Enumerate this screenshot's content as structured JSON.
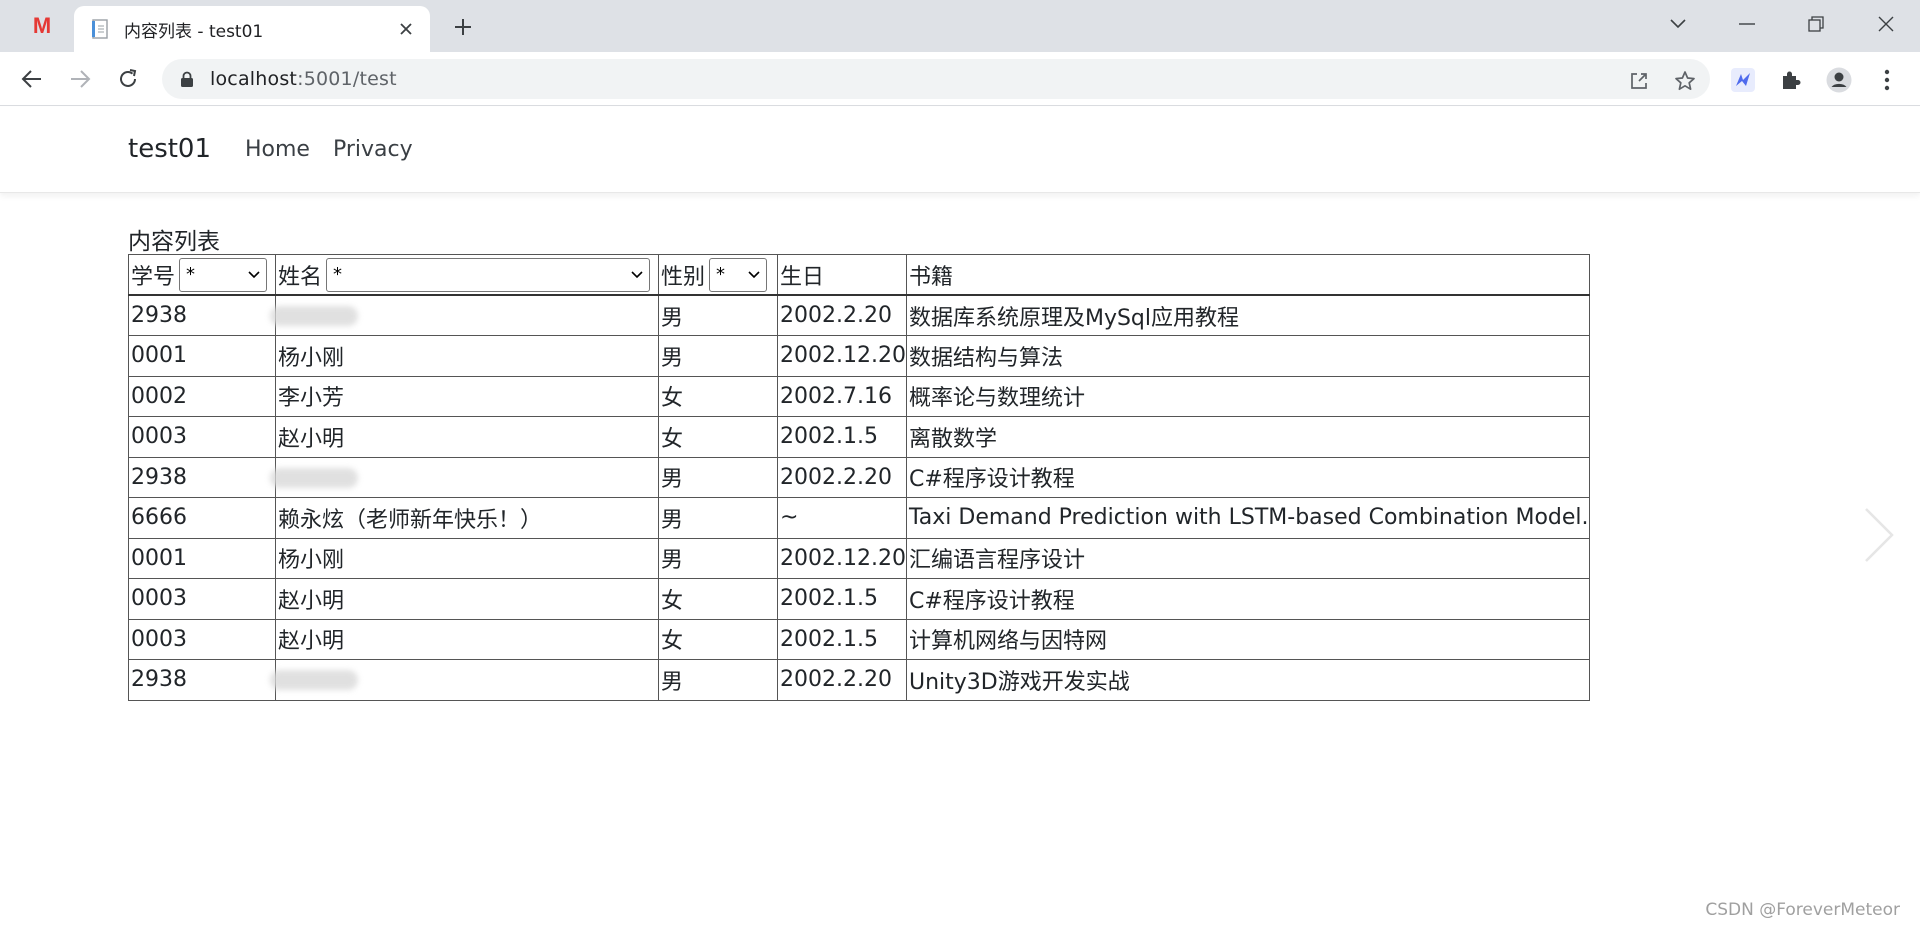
{
  "browser": {
    "pinned_tab_icon": "M",
    "active_tab_title": "内容列表 - test01",
    "url_host": "localhost",
    "url_path": ":5001/test",
    "icons": [
      "back-icon",
      "forward-icon",
      "reload-icon",
      "lock-icon",
      "share-icon",
      "star-icon",
      "extension-bird-icon",
      "puzzle-icon",
      "profile-icon",
      "more-icon"
    ]
  },
  "site": {
    "brand": "test01",
    "nav": [
      "Home",
      "Privacy"
    ]
  },
  "page": {
    "caption": "内容列表",
    "headers": {
      "id": "学号",
      "name": "姓名",
      "gender": "性别",
      "birthday": "生日",
      "book": "书籍"
    },
    "filters": {
      "id": "*",
      "name": "*",
      "gender": "*"
    },
    "rows": [
      {
        "id": "2938",
        "name": "",
        "name_blurred": true,
        "gender": "男",
        "birthday": "2002.2.20",
        "book": "数据库系统原理及MySql应用教程"
      },
      {
        "id": "0001",
        "name": "杨小刚",
        "gender": "男",
        "birthday": "2002.12.20",
        "book": "数据结构与算法"
      },
      {
        "id": "0002",
        "name": "李小芳",
        "gender": "女",
        "birthday": "2002.7.16",
        "book": "概率论与数理统计"
      },
      {
        "id": "0003",
        "name": "赵小明",
        "gender": "女",
        "birthday": "2002.1.5",
        "book": "离散数学"
      },
      {
        "id": "2938",
        "name": "",
        "name_blurred": true,
        "gender": "男",
        "birthday": "2002.2.20",
        "book": "C#程序设计教程"
      },
      {
        "id": "6666",
        "name": "赖永炫（老师新年快乐！）",
        "gender": "男",
        "birthday": "~",
        "book": "Taxi Demand Prediction with LSTM-based Combination Model."
      },
      {
        "id": "0001",
        "name": "杨小刚",
        "gender": "男",
        "birthday": "2002.12.20",
        "book": "汇编语言程序设计"
      },
      {
        "id": "0003",
        "name": "赵小明",
        "gender": "女",
        "birthday": "2002.1.5",
        "book": "C#程序设计教程"
      },
      {
        "id": "0003",
        "name": "赵小明",
        "gender": "女",
        "birthday": "2002.1.5",
        "book": "计算机网络与因特网"
      },
      {
        "id": "2938",
        "name": "",
        "name_blurred": true,
        "gender": "男",
        "birthday": "2002.2.20",
        "book": "Unity3D游戏开发实战"
      }
    ]
  },
  "watermark": "CSDN @ForeverMeteor",
  "colors": {
    "tabstrip": "#dee1e6",
    "omnibox": "#f1f3f4",
    "pinned_logo": "#e53935",
    "extension_accent": "#4f6bed"
  }
}
